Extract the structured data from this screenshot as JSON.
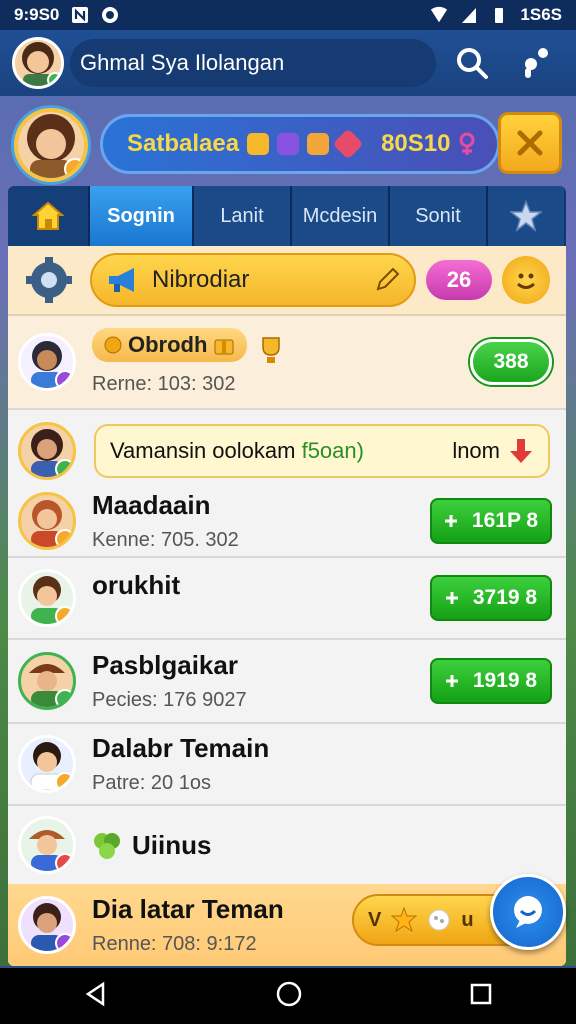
{
  "status_bar": {
    "time": "9:9S0",
    "battery_text": "1S6S"
  },
  "header": {
    "title": "Ghmal Sya Ilolangan"
  },
  "profile": {
    "name": "Satbalaea",
    "score": "80S10"
  },
  "tabs": [
    {
      "label": "Sognin"
    },
    {
      "label": "Lanit"
    },
    {
      "label": "Mcdesin"
    },
    {
      "label": "Sonit"
    }
  ],
  "search": {
    "text": "Nibrodiar",
    "count": "26"
  },
  "list": [
    {
      "tag": "Obrodh",
      "sub": "Rerne: 103: 302",
      "score": "388"
    },
    {
      "message_prefix": "Vamansin oolokam ",
      "message_highlight": "f5oan)",
      "trailing": "lnom"
    },
    {
      "name": "Maadaain",
      "sub": "Kenne: 705. 302",
      "value": "161P 8"
    },
    {
      "name": "orukhit",
      "value": "3719 8"
    },
    {
      "name": "Pasblgaikar",
      "sub": "Pecies: 176 9027",
      "value": "1919 8"
    },
    {
      "name": "Dalabr Temain",
      "sub": "Patre: 20 1os"
    },
    {
      "name": "Uiinus"
    }
  ],
  "bottom_item": {
    "name": "Dia latar Teman",
    "sub": "Renne: 708: 9:172",
    "reward_prefix": "V",
    "reward_suffix": "u"
  },
  "colors": {
    "accent_blue": "#1a77d0",
    "gold": "#f6c343",
    "green": "#1ca61d"
  }
}
